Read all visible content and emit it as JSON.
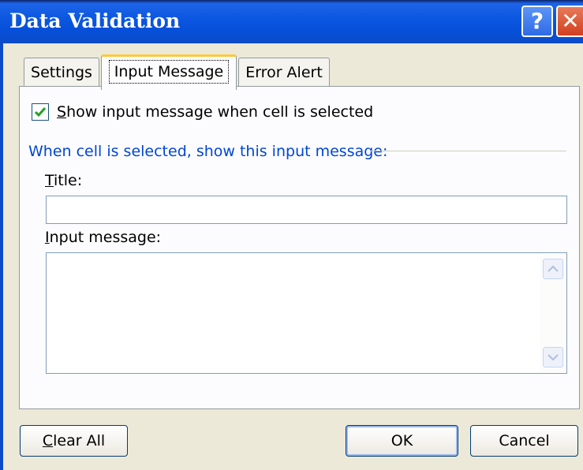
{
  "window": {
    "title": "Data Validation",
    "help_label": "?",
    "close_label": "✕"
  },
  "tabs": [
    {
      "label": "Settings"
    },
    {
      "label": "Input Message",
      "selected": true
    },
    {
      "label": "Error Alert"
    }
  ],
  "input_message": {
    "show_checkbox": {
      "label_u": "S",
      "label_rest": "how input message when cell is selected",
      "checked": true
    },
    "group_label": "When cell is selected, show this input message:",
    "title_label_u": "T",
    "title_label_rest": "itle:",
    "title_value": "",
    "message_label_u": "I",
    "message_label_rest": "nput message:",
    "message_value": ""
  },
  "buttons": {
    "clear_all_u": "C",
    "clear_all_rest": "lear All",
    "ok": "OK",
    "cancel": "Cancel"
  },
  "icons": {
    "help": "help-icon",
    "close": "close-icon",
    "check": "checkmark-icon",
    "scroll_up": "scroll-up-arrow-icon",
    "scroll_down": "scroll-down-arrow-icon"
  },
  "colors": {
    "titlebar": "#0b56e0",
    "group_label": "#0046d5",
    "dialog_bg": "#ece9d8",
    "tab_highlight": "#ffc83c"
  }
}
